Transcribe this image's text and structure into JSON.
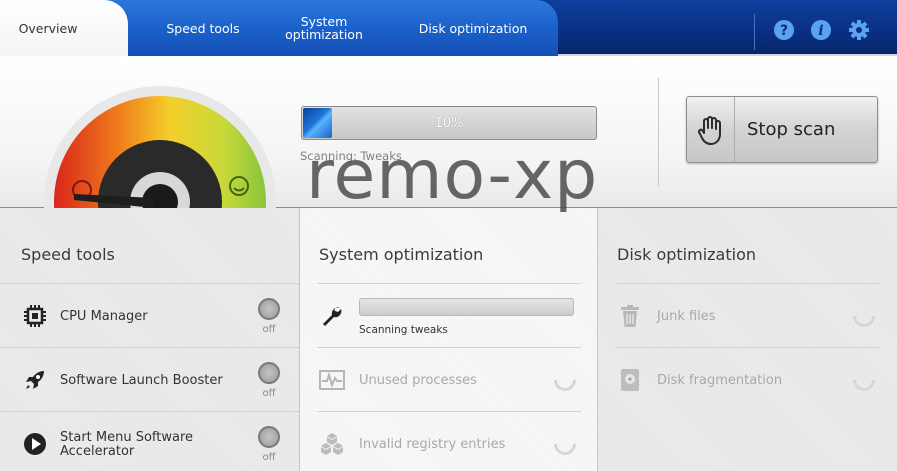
{
  "nav": {
    "tabs": [
      {
        "label": "Overview"
      },
      {
        "label": "Speed tools"
      },
      {
        "label_line1": "System",
        "label_line2": "optimization"
      },
      {
        "label": "Disk optimization"
      }
    ],
    "icons": [
      "help-icon",
      "info-icon",
      "gear-icon"
    ],
    "help_glyph": "?",
    "info_glyph": "i"
  },
  "scan": {
    "progress_value": 10,
    "progress_text": "10%",
    "status_text": "Scanning: Tweaks",
    "stop_button_label": "Stop scan"
  },
  "speed_tools": {
    "title": "Speed tools",
    "items": [
      {
        "label": "CPU Manager",
        "state": "off",
        "icon": "cpu-chip-icon"
      },
      {
        "label": "Software Launch Booster",
        "state": "off",
        "icon": "rocket-icon"
      },
      {
        "label_line1": "Start Menu Software",
        "label_line2": "Accelerator",
        "state": "off",
        "icon": "play-icon"
      }
    ]
  },
  "system_optimization": {
    "title": "System optimization",
    "items": [
      {
        "label": "Scanning tweaks",
        "icon": "wrench-icon"
      },
      {
        "label": "Unused processes",
        "icon": "pulse-icon"
      },
      {
        "label": "Invalid registry entries",
        "icon": "registry-cubes-icon"
      }
    ]
  },
  "disk_optimization": {
    "title": "Disk optimization",
    "items": [
      {
        "label": "Junk files",
        "icon": "trash-icon"
      },
      {
        "label": "Disk fragmentation",
        "icon": "disk-icon"
      }
    ]
  },
  "watermark": "remo-xp",
  "colors": {
    "nav_dark": "#0a2f80",
    "tab_blue": "#1a5fc9",
    "progress_blue": "#1f77d9"
  }
}
